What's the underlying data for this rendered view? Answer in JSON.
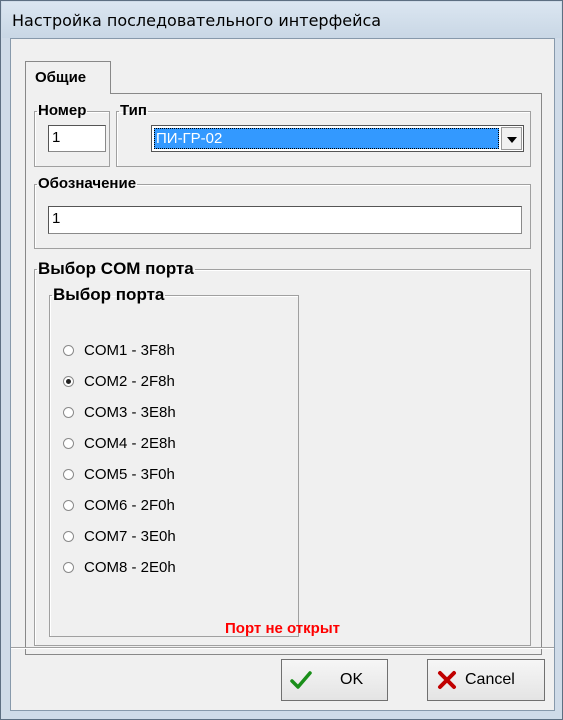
{
  "window": {
    "title": "Настройка последовательного интерфейса"
  },
  "tabs": [
    {
      "label": "Общие",
      "selected": true
    }
  ],
  "number_group": {
    "legend": "Номер",
    "value": "1"
  },
  "type_group": {
    "legend": "Тип",
    "selected": "ПИ-ГР-02"
  },
  "designation_group": {
    "legend": "Обозначение",
    "value": "1"
  },
  "com_group": {
    "legend": "Выбор COM порта",
    "port_legend": "Выбор порта",
    "ports": [
      {
        "label": "COM1 - 3F8h",
        "checked": false
      },
      {
        "label": "COM2 - 2F8h",
        "checked": true
      },
      {
        "label": "COM3 - 3E8h",
        "checked": false
      },
      {
        "label": "COM4 - 2E8h",
        "checked": false
      },
      {
        "label": "COM5 - 3F0h",
        "checked": false
      },
      {
        "label": "COM6 - 2F0h",
        "checked": false
      },
      {
        "label": "COM7 - 3E0h",
        "checked": false
      },
      {
        "label": "COM8 - 2E0h",
        "checked": false
      }
    ]
  },
  "status": {
    "text": "Порт не открыт",
    "color": "#ff0000"
  },
  "buttons": {
    "ok_label": "OK",
    "cancel_label": "Cancel",
    "ok_icon": "checkmark-icon",
    "cancel_icon": "cross-icon"
  }
}
